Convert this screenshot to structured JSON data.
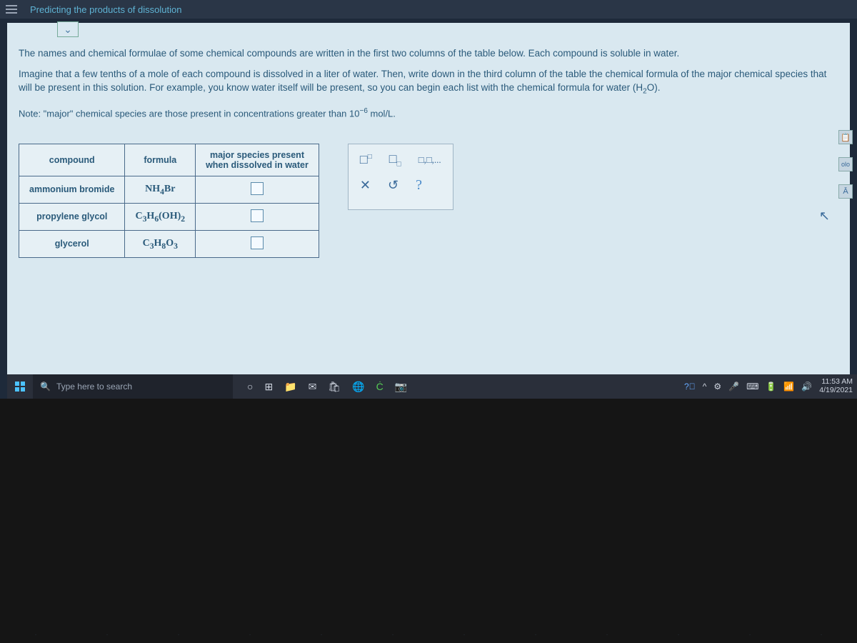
{
  "topbar": {
    "title": "Predicting the products of dissolution"
  },
  "instructions": {
    "p1": "The names and chemical formulae of some chemical compounds are written in the first two columns of the table below. Each compound is soluble in water.",
    "p2_a": "Imagine that a few tenths of a mole of each compound is dissolved in a liter of water. Then, write down in the third column of the table the chemical formula of the major chemical species that will be present in this solution. For example, you know water itself will be present, so you can begin each list with the chemical formula for water (H",
    "p2_sub": "2",
    "p2_b": "O).",
    "note_a": "Note: \"major\" chemical species are those present in concentrations greater than 10",
    "note_sup": "−6",
    "note_b": " mol/L."
  },
  "table": {
    "headers": {
      "c1": "compound",
      "c2": "formula",
      "c3": "major species present\nwhen dissolved in water"
    },
    "rows": [
      {
        "compound": "ammonium bromide",
        "formula_html": "NH<sub>4</sub>Br"
      },
      {
        "compound": "propylene glycol",
        "formula_html": "C<sub>3</sub>H<sub>6</sub>(OH)<sub>2</sub>"
      },
      {
        "compound": "glycerol",
        "formula_html": "C<sub>3</sub>H<sub>8</sub>O<sub>3</sub>"
      }
    ]
  },
  "toolpanel": {
    "row1": [
      "□<sup>□</sup>",
      "□<sub>□</sub>",
      "□,□,..."
    ],
    "row2": [
      "✕",
      "↺",
      "?"
    ]
  },
  "right_icons": [
    "📋",
    "olo",
    "Ā"
  ],
  "taskbar": {
    "search_placeholder": "Type here to search",
    "clock_time": "11:53 AM",
    "clock_date": "4/19/2021"
  }
}
